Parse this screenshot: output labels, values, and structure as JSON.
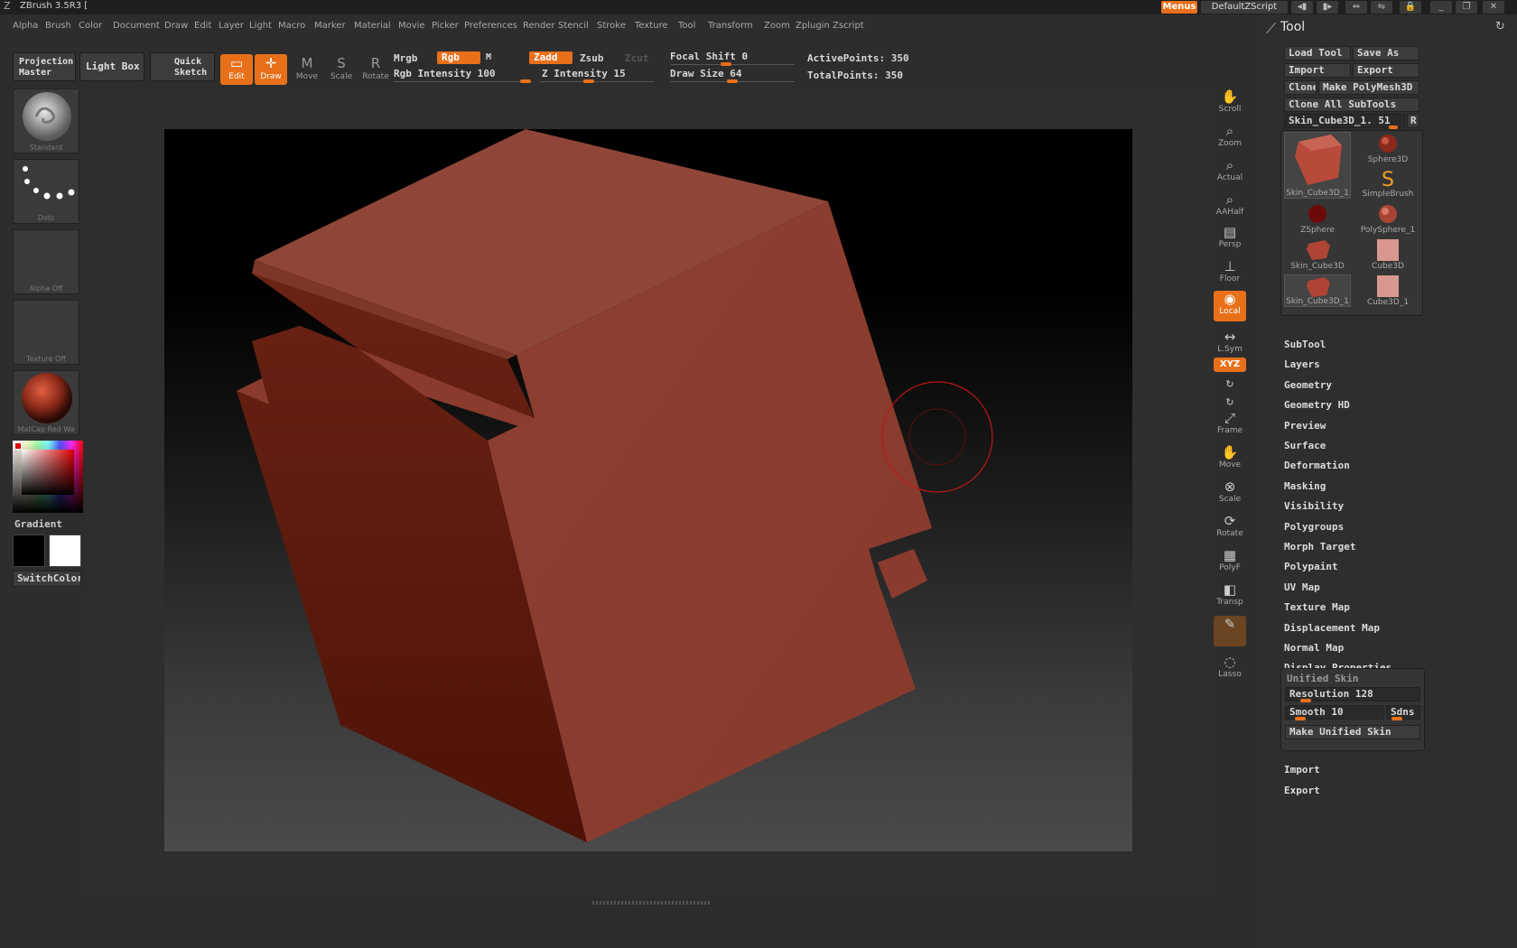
{
  "app": {
    "title": "ZBrush 3.5R3 [",
    "menus_label": "Menus",
    "script_label": "DefaultZScript"
  },
  "menubar": [
    "Alpha",
    "Brush",
    "Color",
    "Document",
    "Draw",
    "Edit",
    "Layer",
    "Light",
    "Macro",
    "Marker",
    "Material",
    "Movie",
    "Picker",
    "Preferences",
    "Render",
    "Stencil",
    "Stroke",
    "Texture",
    "Tool",
    "Transform",
    "Zoom",
    "Zplugin",
    "Zscript"
  ],
  "toolbar": {
    "projection_master": "Projection Master",
    "light_box": "Light Box",
    "quick_sketch": "Quick Sketch",
    "modes": [
      {
        "label": "Edit",
        "active": true
      },
      {
        "label": "Draw",
        "active": true
      },
      {
        "label": "Move",
        "active": false
      },
      {
        "label": "Scale",
        "active": false
      },
      {
        "label": "Rotate",
        "active": false
      }
    ],
    "mrgb": "Mrgb",
    "rgb": "Rgb",
    "m": "M",
    "rgb_intensity": "Rgb Intensity 100",
    "zadd": "Zadd",
    "zsub": "Zsub",
    "zcut": "Zcut",
    "z_intensity": "Z Intensity 15",
    "focal_shift": "Focal Shift 0",
    "draw_size": "Draw Size 64",
    "active_points": "ActivePoints: 350",
    "total_points": "TotalPoints: 350",
    "rgb_intensity_value": 100,
    "z_intensity_value": 15,
    "focal_shift_value": 0,
    "draw_size_value": 64
  },
  "left_shelf": {
    "brush": "Standard",
    "stroke": "Dots",
    "alpha": "Alpha Off",
    "texture": "Texture Off",
    "material": "MatCap Red Wa",
    "gradient": "Gradient",
    "switch_color": "SwitchColor"
  },
  "right_toolbar": [
    {
      "label": "Scroll",
      "icon": "scroll-icon",
      "state": "off"
    },
    {
      "label": "Zoom",
      "icon": "zoom-icon",
      "state": "off"
    },
    {
      "label": "Actual",
      "icon": "actual-icon",
      "state": "off"
    },
    {
      "label": "AAHalf",
      "icon": "aahalf-icon",
      "state": "off"
    },
    {
      "label": "Persp",
      "icon": "persp-icon",
      "state": "off"
    },
    {
      "label": "Floor",
      "icon": "floor-icon",
      "state": "off"
    },
    {
      "label": "Local",
      "icon": "local-icon",
      "state": "on"
    },
    {
      "label": "L.Sym",
      "icon": "lsym-icon",
      "state": "off"
    },
    {
      "label": "Frame",
      "icon": "frame-icon",
      "state": "off"
    },
    {
      "label": "Move",
      "icon": "move-icon",
      "state": "off"
    },
    {
      "label": "Scale",
      "icon": "scale-icon",
      "state": "off"
    },
    {
      "label": "Rotate",
      "icon": "rotate-icon",
      "state": "off"
    },
    {
      "label": "PolyF",
      "icon": "polyf-icon",
      "state": "off"
    },
    {
      "label": "Transp",
      "icon": "transp-icon",
      "state": "off"
    },
    {
      "label": "",
      "icon": "ghost-icon",
      "state": "dim"
    },
    {
      "label": "Lasso",
      "icon": "lasso-icon",
      "state": "off"
    }
  ],
  "xyz_label": "XYZ",
  "tool_panel": {
    "title": "Tool",
    "load_tool": "Load Tool",
    "save_as": "Save As",
    "import": "Import",
    "export": "Export",
    "clone": "Clone",
    "make_polymesh": "Make PolyMesh3D",
    "clone_all": "Clone All SubTools",
    "current_tool": "Skin_Cube3D_1. 51",
    "r_button": "R",
    "thumbs": [
      {
        "label": "Skin_Cube3D_1",
        "kind": "cube-big"
      },
      {
        "label": "Sphere3D",
        "kind": "sphere"
      },
      {
        "label": "SimpleBrush",
        "kind": "brush"
      },
      {
        "label": "ZSphere",
        "kind": "zsphere"
      },
      {
        "label": "PolySphere_1",
        "kind": "polysphere"
      },
      {
        "label": "Skin_Cube3D",
        "kind": "cube"
      },
      {
        "label": "Cube3D",
        "kind": "flatcube"
      },
      {
        "label": "Skin_Cube3D_1",
        "kind": "cube"
      },
      {
        "label": "Cube3D_1",
        "kind": "flatcube"
      }
    ],
    "sections": [
      "SubTool",
      "Layers",
      "Geometry",
      "Geometry HD",
      "Preview",
      "Surface",
      "Deformation",
      "Masking",
      "Visibility",
      "Polygroups",
      "Morph Target",
      "Polypaint",
      "UV Map",
      "Texture Map",
      "Displacement Map",
      "Normal Map",
      "Display Properties"
    ],
    "unified_skin": {
      "title": "Unified Skin",
      "resolution": "Resolution 128",
      "smooth": "Smooth 10",
      "sdns": "Sdns",
      "make": "Make Unified Skin",
      "resolution_value": 128,
      "smooth_value": 10
    },
    "footer": [
      "Import",
      "Export"
    ]
  },
  "colors": {
    "accent": "#e8701a",
    "model": "#8b3a2e"
  }
}
